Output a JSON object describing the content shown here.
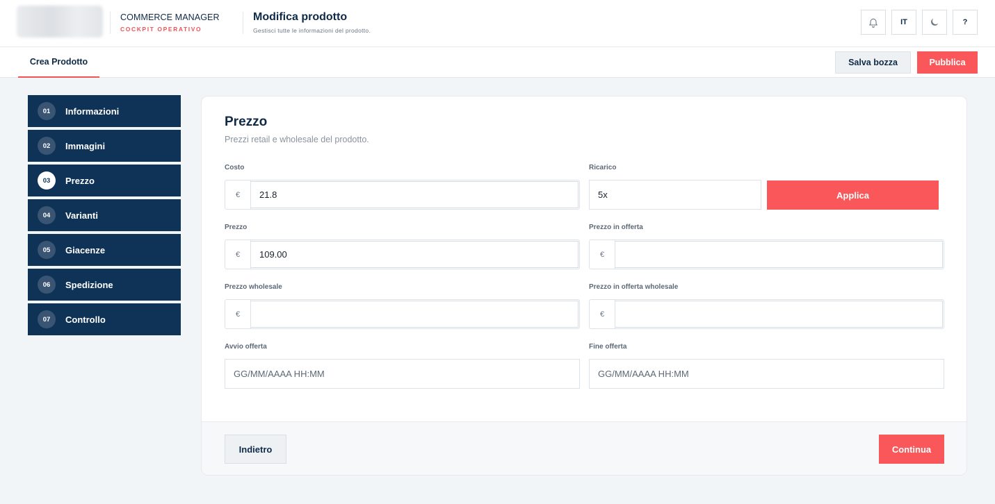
{
  "header": {
    "brand_title": "COMMERCE MANAGER",
    "brand_subtitle": "COCKPIT OPERATIVO",
    "page_title": "Modifica prodotto",
    "page_subtitle": "Gestisci tutte le informazioni del prodotto.",
    "language": "IT",
    "help": "?",
    "icons": [
      "bell-icon",
      "moon-icon"
    ]
  },
  "tabbar": {
    "active_tab": "Crea Prodotto",
    "save_draft": "Salva bozza",
    "publish": "Pubblica"
  },
  "steps": [
    {
      "num": "01",
      "label": "Informazioni"
    },
    {
      "num": "02",
      "label": "Immagini"
    },
    {
      "num": "03",
      "label": "Prezzo",
      "active": true
    },
    {
      "num": "04",
      "label": "Varianti"
    },
    {
      "num": "05",
      "label": "Giacenze"
    },
    {
      "num": "06",
      "label": "Spedizione"
    },
    {
      "num": "07",
      "label": "Controllo"
    }
  ],
  "form": {
    "title": "Prezzo",
    "subtitle": "Prezzi retail e wholesale del prodotto.",
    "currency": "€",
    "cost": {
      "label": "Costo",
      "value": "21.8"
    },
    "markup": {
      "label": "Ricarico",
      "value": "5x"
    },
    "apply": "Applica",
    "price": {
      "label": "Prezzo",
      "value": "109.00"
    },
    "sale_price": {
      "label": "Prezzo in offerta",
      "value": ""
    },
    "wholesale_price": {
      "label": "Prezzo wholesale",
      "value": ""
    },
    "wholesale_sale_price": {
      "label": "Prezzo in offerta wholesale",
      "value": ""
    },
    "offer_start": {
      "label": "Avvio offerta",
      "placeholder": "GG/MM/AAAA HH:MM"
    },
    "offer_end": {
      "label": "Fine offerta",
      "placeholder": "GG/MM/AAAA HH:MM"
    },
    "back": "Indietro",
    "continue": "Continua"
  },
  "colors": {
    "accent": "#fa575a",
    "navy": "#0f3356"
  }
}
